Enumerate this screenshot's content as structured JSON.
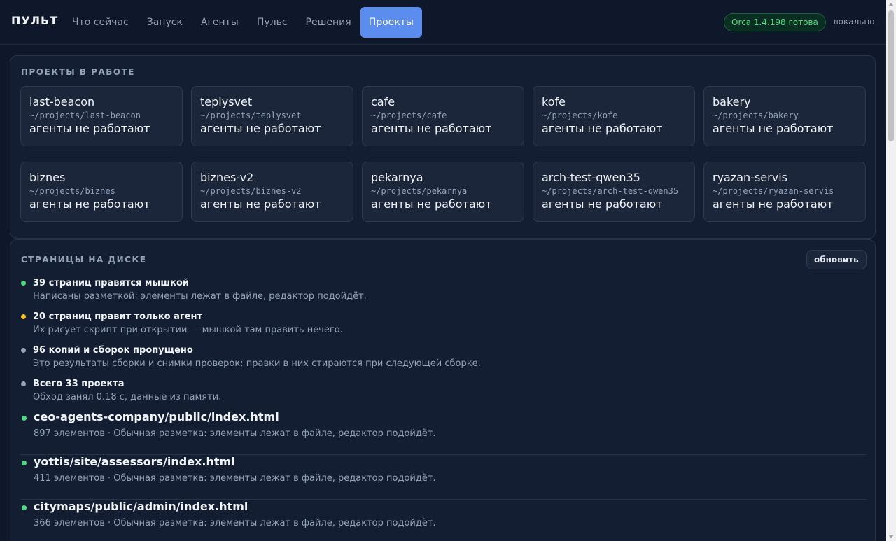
{
  "app": {
    "brand": "ПУЛЬТ"
  },
  "nav": [
    {
      "label": "Что сейчас",
      "active": false
    },
    {
      "label": "Запуск",
      "active": false
    },
    {
      "label": "Агенты",
      "active": false
    },
    {
      "label": "Пульс",
      "active": false
    },
    {
      "label": "Решения",
      "active": false
    },
    {
      "label": "Проекты",
      "active": true
    }
  ],
  "header": {
    "version_badge": "Orca 1.4.198 готова",
    "mode": "локально"
  },
  "colors": {
    "accent": "#5b8def",
    "ok": "#4ade80",
    "warn": "#fbbf24",
    "muted": "#94a3b8"
  },
  "projects": {
    "title": "ПРОЕКТЫ В РАБОТЕ",
    "items": [
      {
        "name": "last-beacon",
        "path": "~/projects/last-beacon",
        "status": "агенты не работают"
      },
      {
        "name": "teplysvet",
        "path": "~/projects/teplysvet",
        "status": "агенты не работают"
      },
      {
        "name": "cafe",
        "path": "~/projects/cafe",
        "status": "агенты не работают"
      },
      {
        "name": "kofe",
        "path": "~/projects/kofe",
        "status": "агенты не работают"
      },
      {
        "name": "bakery",
        "path": "~/projects/bakery",
        "status": "агенты не работают"
      },
      {
        "name": "biznes",
        "path": "~/projects/biznes",
        "status": "агенты не работают"
      },
      {
        "name": "biznes-v2",
        "path": "~/projects/biznes-v2",
        "status": "агенты не работают"
      },
      {
        "name": "pekarnya",
        "path": "~/projects/pekarnya",
        "status": "агенты не работают"
      },
      {
        "name": "arch-test-qwen35",
        "path": "~/projects/arch-test-qwen35",
        "status": "агенты не работают"
      },
      {
        "name": "ryazan-servis",
        "path": "~/projects/ryazan-servis",
        "status": "агенты не работают"
      }
    ]
  },
  "pages": {
    "title": "СТРАНИЦЫ НА ДИСКЕ",
    "refresh_label": "обновить",
    "summary": [
      {
        "title": "39 страниц правятся мышкой",
        "desc": "Написаны разметкой: элементы лежат в файле, редактор подойдёт.",
        "color": "#4ade80"
      },
      {
        "title": "20 страниц правит только агент",
        "desc": "Их рисует скрипт при открытии — мышкой там править нечего.",
        "color": "#fbbf24"
      },
      {
        "title": "96 копий и сборок пропущено",
        "desc": "Это результаты сборки и снимки проверок: правки в них стираются при следующей сборке.",
        "color": "#94a3b8"
      },
      {
        "title": "Всего 33 проекта",
        "desc": "Обход занял 0.18 с, данные из памяти.",
        "color": "#94a3b8"
      }
    ],
    "files": [
      {
        "path": "ceo-agents-company/public/index.html",
        "desc": "897 элементов · Обычная разметка: элементы лежат в файле, редактор подойдёт.",
        "color": "#4ade80"
      },
      {
        "path": "yottis/site/assessors/index.html",
        "desc": "411 элементов · Обычная разметка: элементы лежат в файле, редактор подойдёт.",
        "color": "#4ade80"
      },
      {
        "path": "citymaps/public/admin/index.html",
        "desc": "366 элементов · Обычная разметка: элементы лежат в файле, редактор подойдёт.",
        "color": "#4ade80"
      }
    ]
  }
}
